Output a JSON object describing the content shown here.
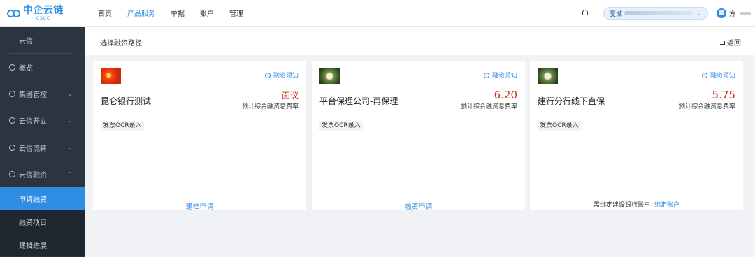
{
  "logo": {
    "name": "中企云链",
    "sub": "CSCC"
  },
  "nav": [
    "首页",
    "产品服务",
    "单据",
    "账户",
    "管理"
  ],
  "header": {
    "company_prefix": "夏城"
  },
  "user": {
    "name": "方"
  },
  "sidebar": {
    "top": "云信",
    "items": [
      {
        "label": "概览",
        "icon": "layers-icon"
      },
      {
        "label": "集团管控",
        "icon": "globe-icon"
      },
      {
        "label": "云信开立",
        "icon": "user-icon"
      },
      {
        "label": "云信流转",
        "icon": "cloud-icon"
      },
      {
        "label": "云信融资",
        "icon": "cloud-icon"
      }
    ],
    "sub": [
      "申请融资",
      "融资项目",
      "建档进展"
    ]
  },
  "page": {
    "title": "选择融资路径",
    "back": "返回"
  },
  "cards": [
    {
      "name": "昆仑银行测试",
      "rate": "面议",
      "rate_label": "预计综合融资息费率",
      "notice": "融资须知",
      "tag": "发票OCR录入",
      "action": "建档申请"
    },
    {
      "name": "平台保理公司-再保理",
      "rate": "6.20",
      "rate_label": "预计综合融资息费率",
      "notice": "融资须知",
      "tag": "发票OCR录入",
      "action": "融资申请"
    },
    {
      "name": "建行分行线下直保",
      "rate": "5.75",
      "rate_label": "预计综合融资息费率",
      "notice": "融资须知",
      "tag": "发票OCR录入",
      "foot_text": "需绑定建设银行账户",
      "foot_link": "绑定账户"
    }
  ],
  "colors": {
    "accent": "#2f8de4",
    "rate": "#c92b1a",
    "sidebar": "#2b3540"
  }
}
